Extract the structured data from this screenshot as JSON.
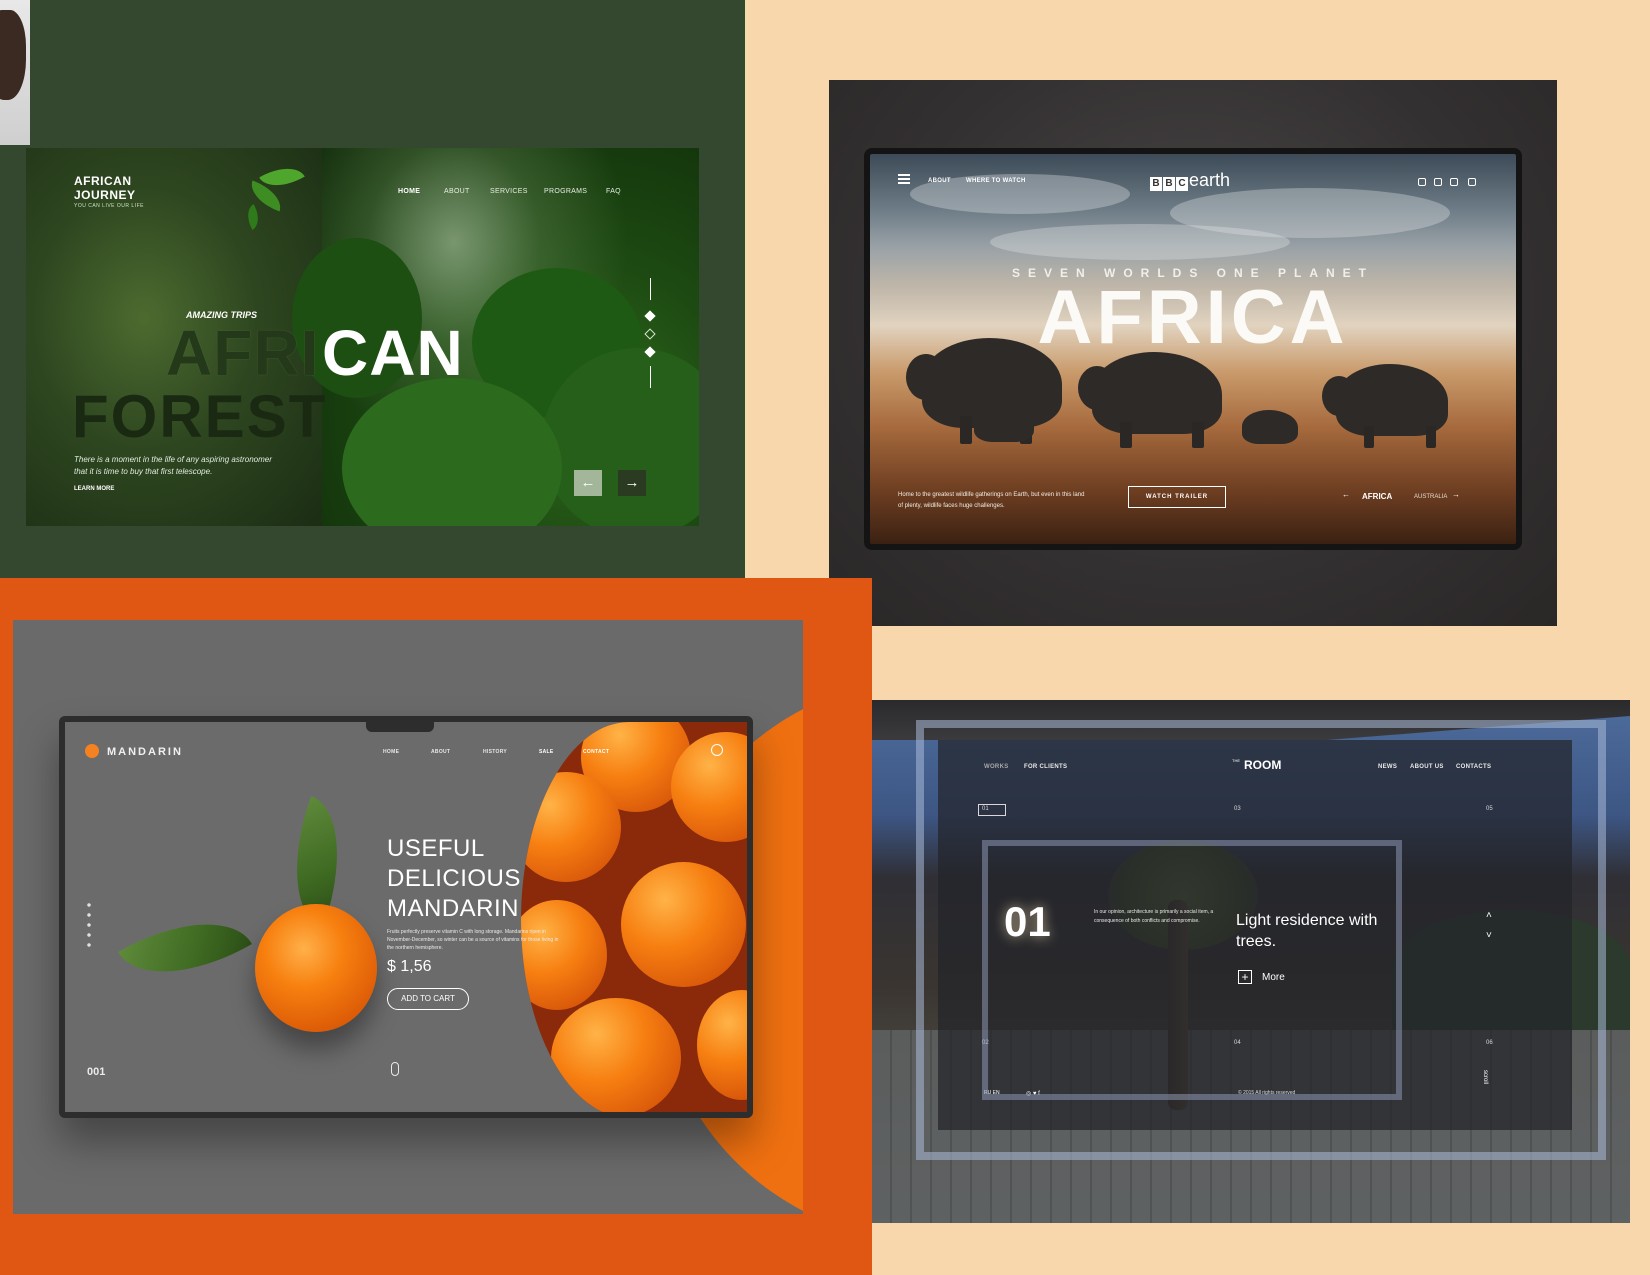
{
  "panels": {
    "african_forest": {
      "logo_line1": "AFRICAN",
      "logo_line2": "JOURNEY",
      "logo_tagline": "YOU CAN LIVE OUR LIFE",
      "nav": [
        "HOME",
        "ABOUT",
        "SERVICES",
        "PROGRAMS",
        "FAQ"
      ],
      "kicker": "AMAZING TRIPS",
      "headline_part1": "AFRI",
      "headline_part2": "CAN",
      "headline_line2": "FOREST",
      "description": "There is a moment in the life of any aspiring astronomer that it is time to buy that first telescope.",
      "learn_more": "LEARN MORE",
      "prev_icon": "←",
      "next_icon": "→",
      "colors": {
        "panel_bg": "#34472f",
        "accent": "#a3b69a"
      }
    },
    "bbc_earth": {
      "nav": [
        "ABOUT",
        "WHERE TO WATCH"
      ],
      "logo_boxes": [
        "B",
        "B",
        "C"
      ],
      "logo_word": "earth",
      "kicker": "SEVEN WORLDS ONE PLANET",
      "title": "AFRICA",
      "description": "Home to the greatest wildlife gatherings on Earth, but even in this land of plenty, wildlife faces huge challenges.",
      "cta": "WATCH TRAILER",
      "pager_active": "AFRICA",
      "pager_next": "AUSTRALIA",
      "pager_prev_icon": "←",
      "pager_next_icon": "→",
      "social_icons": [
        "facebook-icon",
        "twitter-icon",
        "instagram-icon",
        "youtube-icon"
      ],
      "colors": {
        "panel_bg": "#f9d7ad"
      }
    },
    "mandarin": {
      "brand": "MANDARIN",
      "nav": [
        "HOME",
        "ABOUT",
        "HISTORY",
        "SALE",
        "CONTACT"
      ],
      "headline": [
        "USEFUL",
        "DELICIOUS",
        "MANDARIN"
      ],
      "description": "Fruits perfectly preserve vitamin C with long storage. Mandarins ripen in November-December, so winter can be a source of vitamins for those living in the northern hemisphere.",
      "price": "$ 1,56",
      "cta": "ADD TO CART",
      "slide_number": "001",
      "colors": {
        "panel_bg": "#df5713",
        "accent": "#f58220",
        "screen_bg": "#6b6b6b"
      }
    },
    "the_room": {
      "nav_left": [
        "WORKS",
        "FOR CLIENTS"
      ],
      "logo_small": "THE",
      "logo": "ROOM",
      "nav_right": [
        "NEWS",
        "ABOUT US",
        "CONTACTS"
      ],
      "indices": [
        "01",
        "02",
        "03",
        "04",
        "05",
        "06"
      ],
      "big_number": "01",
      "quote": "In our opinion, architecture is primarily a social item, a consequence of both conflicts and compromise.",
      "headline": "Light residence with trees.",
      "more": "More",
      "plus_icon": "+",
      "up_icon": "˄",
      "down_icon": "˅",
      "lang": "RU   EN",
      "social": "◎  ♥  f",
      "copyright": "© 2015  All rights reserved",
      "scroll": "scroll",
      "colors": {
        "panel_bg": "#f9d7ad"
      }
    }
  }
}
